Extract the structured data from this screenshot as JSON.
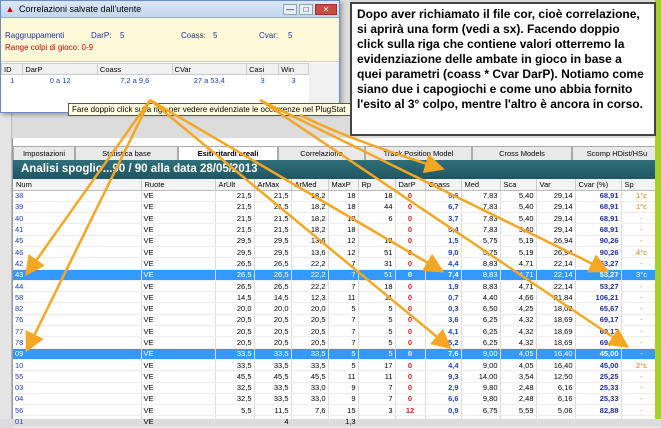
{
  "dialog": {
    "title": "Correlazioni salvate dall'utente",
    "info": {
      "raggruppamenti": "Raggruppamenti",
      "darp": "DarP:",
      "darp_val": "5",
      "coass": "Coass:",
      "coass_val": "5",
      "cvar": "Cvar:",
      "cvar_val": "5",
      "range": "Range colpi di gioco: 0-9"
    },
    "columns": [
      "ID",
      "DarP",
      "Coass",
      "CVar",
      "Casi",
      "Win"
    ],
    "rows": [
      [
        "1",
        "0 a 12",
        "7,2 a 9,6",
        "27 a 53,4",
        "3",
        "3"
      ]
    ]
  },
  "tooltip": "Fare doppio click sulla riga per vedere evidenziate le occorrenze nel PlugStat",
  "callout": "Dopo aver richiamato il file cor, cioè correlazione, si aprirà una form (vedi a sx). Facendo doppio click sulla riga che contiene valori otterremo la evidenziazione delle ambate in gioco in base a quei parametri (coass * Cvar DarP). Notiamo come siano due i capogiochi e come uno abbia fornito l'esito al 3° colpo, mentre l'altro è ancora in corso.",
  "tabs": [
    "Impostazioni",
    "Statistica base",
    "Esiti ritardi areali",
    "Correlazione",
    "Track Position Model",
    "Cross Models",
    "Scomp HDist/HSu"
  ],
  "active_tab": 2,
  "banner": "Analisi spoglio...90 / 90 alla data 28/05/2013",
  "grid_columns": [
    "Num",
    "Ruote",
    "ArUlt",
    "ArMax",
    "ArMed",
    "MaxP",
    "Rp",
    "DarP",
    "Coass",
    "Med",
    "Sca",
    "Var",
    "Cvar (%)",
    "Sp"
  ],
  "grid_rows": [
    {
      "c": [
        "38",
        "VE",
        "21,5",
        "21,5",
        "18,2",
        "18",
        "18",
        "0",
        "5,6",
        "7,83",
        "5,40",
        "29,14",
        "68,91",
        "1°c"
      ],
      "sel": false
    },
    {
      "c": [
        "39",
        "VE",
        "21,5",
        "21,5",
        "18,2",
        "18",
        "44",
        "0",
        "6,7",
        "7,83",
        "5,40",
        "29,14",
        "68,91",
        "1°c"
      ],
      "sel": false
    },
    {
      "c": [
        "40",
        "VE",
        "21,5",
        "21,5",
        "18,2",
        "18",
        "6",
        "0",
        "3,7",
        "7,83",
        "5,40",
        "29,14",
        "68,91",
        "-"
      ],
      "sel": false
    },
    {
      "c": [
        "41",
        "VE",
        "21,5",
        "21,5",
        "18,2",
        "18",
        "",
        "0",
        "5,4",
        "7,83",
        "5,40",
        "29,14",
        "68,91",
        "-"
      ],
      "sel": false
    },
    {
      "c": [
        "45",
        "VE",
        "29,5",
        "29,5",
        "13,6",
        "12",
        "12",
        "0",
        "1,5",
        "5,75",
        "5,19",
        "26,94",
        "90,26",
        "-"
      ],
      "sel": false
    },
    {
      "c": [
        "46",
        "VE",
        "29,5",
        "29,5",
        "13,6",
        "12",
        "51",
        "0",
        "9,0",
        "5,75",
        "5,19",
        "26,94",
        "90,26",
        "4°c"
      ],
      "sel": false
    },
    {
      "c": [
        "42",
        "VE",
        "26,5",
        "26,5",
        "22,2",
        "7",
        "31",
        "0",
        "4,4",
        "8,83",
        "4,71",
        "22,14",
        "53,27",
        "-"
      ],
      "sel": false
    },
    {
      "c": [
        "43",
        "VE",
        "26,5",
        "26,5",
        "22,2",
        "7",
        "51",
        "0",
        "7,4",
        "8,83",
        "4,71",
        "22,14",
        "53,27",
        "3°c"
      ],
      "sel": true
    },
    {
      "c": [
        "44",
        "VE",
        "26,5",
        "26,5",
        "22,2",
        "7",
        "18",
        "0",
        "1,9",
        "8,83",
        "4,71",
        "22,14",
        "53,27",
        "-"
      ],
      "sel": false
    },
    {
      "c": [
        "58",
        "VE",
        "14,5",
        "14,5",
        "12,3",
        "11",
        "11",
        "0",
        "0,7",
        "4,40",
        "4,66",
        "21,84",
        "106,21",
        "-"
      ],
      "sel": false
    },
    {
      "c": [
        "82",
        "VE",
        "20,0",
        "20,0",
        "20,0",
        "5",
        "5",
        "0",
        "0,3",
        "6,50",
        "4,25",
        "18,08",
        "65,67",
        "-"
      ],
      "sel": false
    },
    {
      "c": [
        "76",
        "VE",
        "20,5",
        "20,5",
        "20,5",
        "7",
        "5",
        "0",
        "3,6",
        "6,25",
        "4,32",
        "18,69",
        "69,17",
        "-"
      ],
      "sel": false
    },
    {
      "c": [
        "77",
        "VE",
        "20,5",
        "20,5",
        "20,5",
        "7",
        "5",
        "0",
        "4,1",
        "6,25",
        "4,32",
        "18,69",
        "69,17",
        "-"
      ],
      "sel": false
    },
    {
      "c": [
        "78",
        "VE",
        "20,5",
        "20,5",
        "20,5",
        "7",
        "5",
        "0",
        "5,2",
        "6,25",
        "4,32",
        "18,69",
        "69,17",
        "-"
      ],
      "sel": false
    },
    {
      "c": [
        "09",
        "VE",
        "33,5",
        "33,5",
        "33,5",
        "5",
        "5",
        "0",
        "7,6",
        "9,00",
        "4,05",
        "16,40",
        "45,00",
        "-"
      ],
      "sel": true
    },
    {
      "c": [
        "10",
        "VE",
        "33,5",
        "33,5",
        "33,5",
        "5",
        "17",
        "0",
        "4,4",
        "9,00",
        "4,05",
        "16,40",
        "45,00",
        "2°c"
      ],
      "sel": false
    },
    {
      "c": [
        "55",
        "VE",
        "45,5",
        "45,5",
        "45,5",
        "11",
        "11",
        "0",
        "9,3",
        "14,00",
        "3,54",
        "12,50",
        "25,25",
        "-"
      ],
      "sel": false
    },
    {
      "c": [
        "03",
        "VE",
        "32,5",
        "33,5",
        "33,0",
        "9",
        "7",
        "0",
        "2,9",
        "9,80",
        "2,48",
        "6,16",
        "25,33",
        "-"
      ],
      "sel": false
    },
    {
      "c": [
        "04",
        "VE",
        "32,5",
        "33,5",
        "33,0",
        "9",
        "7",
        "0",
        "6,6",
        "9,80",
        "2,48",
        "6,16",
        "25,33",
        "-"
      ],
      "sel": false
    },
    {
      "c": [
        "56",
        "VE",
        "5,5",
        "11,5",
        "7,6",
        "15",
        "3",
        "12",
        "0,9",
        "6,75",
        "5,59",
        "5,06",
        "82,88",
        "-"
      ],
      "sel": false
    },
    {
      "c": [
        "01",
        "VE",
        "",
        "4",
        "",
        "1,3",
        "",
        "",
        "",
        "",
        "",
        "",
        "",
        ""
      ],
      "sel": false
    }
  ]
}
